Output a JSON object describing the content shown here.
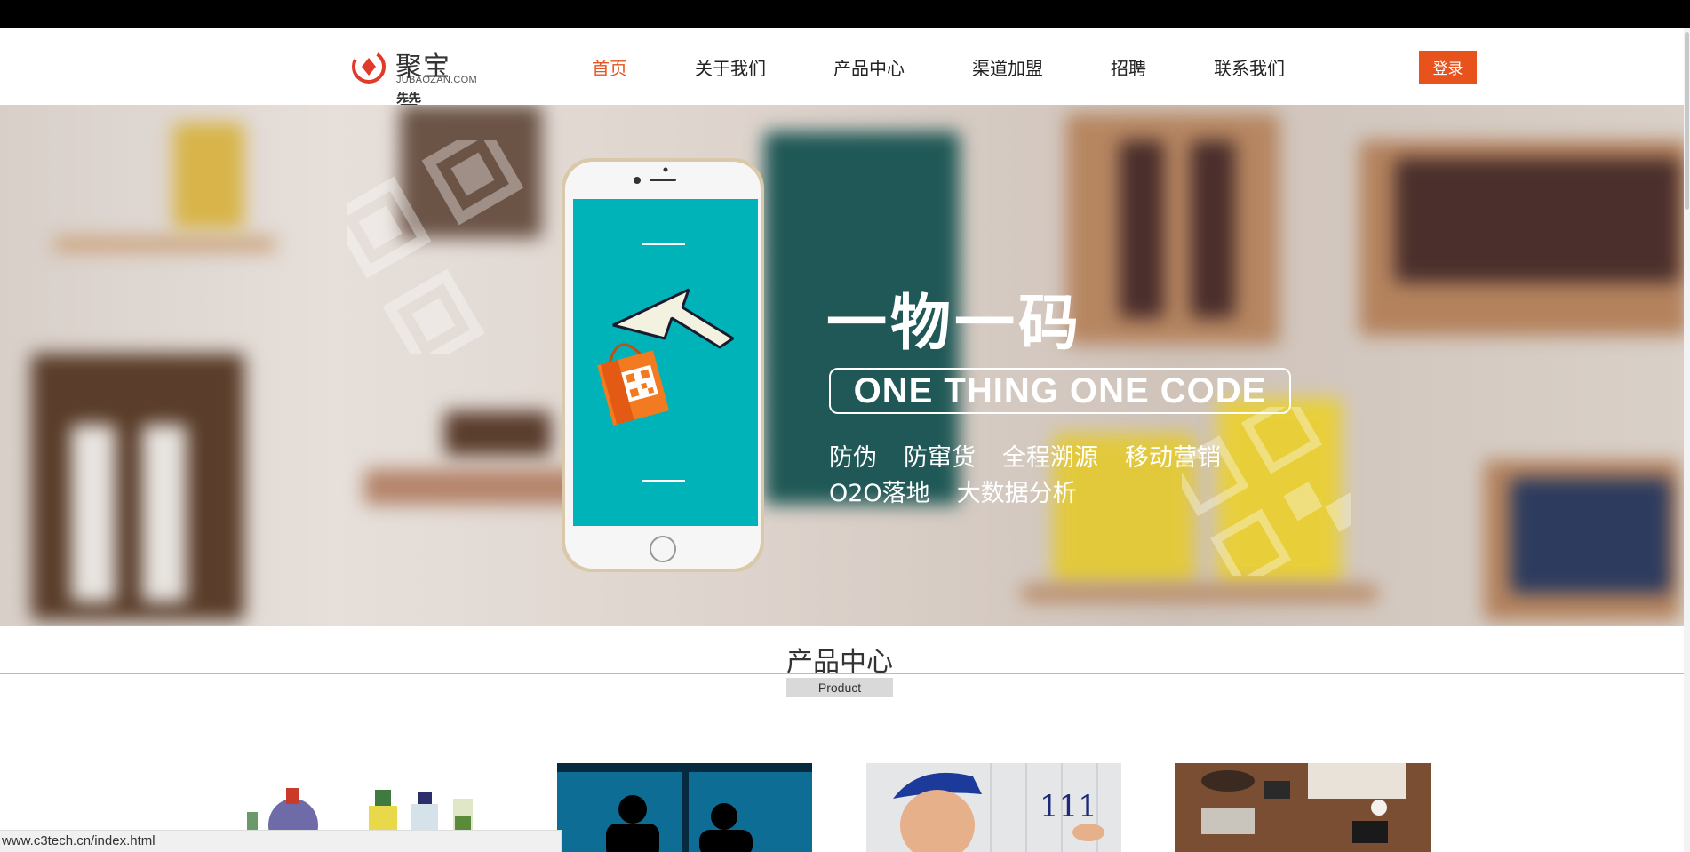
{
  "header": {
    "logo_cn": "聚宝赞",
    "logo_en": "JUBAOZAN.COM",
    "nav": [
      {
        "label": "首页",
        "active": true
      },
      {
        "label": "关于我们",
        "active": false
      },
      {
        "label": "产品中心",
        "active": false
      },
      {
        "label": "渠道加盟",
        "active": false
      },
      {
        "label": "招聘",
        "active": false
      },
      {
        "label": "联系我们",
        "active": false
      }
    ],
    "login_label": "登录"
  },
  "hero": {
    "title": "一物一码",
    "slogan": "ONE THING ONE CODE",
    "features_line1": [
      "防伪",
      "防窜货",
      "全程溯源",
      "移动营销"
    ],
    "features_line2": [
      "O2O落地",
      "大数据分析"
    ]
  },
  "section": {
    "title_cn": "产品中心",
    "title_en": "Product"
  },
  "status_bar": {
    "url": "www.c3tech.cn/index.html"
  },
  "colors": {
    "accent": "#e8521c",
    "phone_screen": "#00b3b8"
  }
}
